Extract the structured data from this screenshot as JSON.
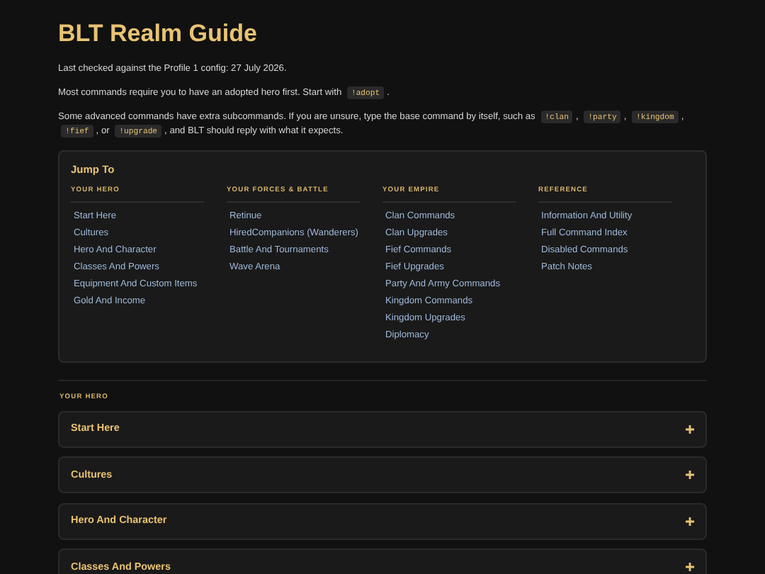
{
  "title": "BLT Realm Guide",
  "paragraphs": [
    [
      {
        "kind": "text",
        "text": "Last checked against the Profile 1 config: 27 July 2026."
      }
    ],
    [
      {
        "kind": "text",
        "text": "Most commands require you to have an adopted hero first. Start with"
      },
      {
        "kind": "code",
        "text": "!adopt"
      },
      {
        "kind": "text",
        "text": "."
      }
    ],
    [
      {
        "kind": "text",
        "text": "Some advanced commands have extra subcommands. If you are unsure, type the base command by itself, such as"
      },
      {
        "kind": "code",
        "text": "!clan"
      },
      {
        "kind": "text",
        "text": ","
      },
      {
        "kind": "code",
        "text": "!party"
      },
      {
        "kind": "text",
        "text": ","
      },
      {
        "kind": "code",
        "text": "!kingdom"
      },
      {
        "kind": "text",
        "text": ","
      },
      {
        "kind": "code",
        "text": "!fief"
      },
      {
        "kind": "text",
        "text": ", or"
      },
      {
        "kind": "code",
        "text": "!upgrade"
      },
      {
        "kind": "text",
        "text": ", and BLT should reply with what it expects."
      }
    ]
  ],
  "jump_to": {
    "title": "Jump To",
    "columns": [
      {
        "heading": "YOUR HERO",
        "links": [
          "Start Here",
          "Cultures",
          "Hero And Character",
          "Classes And Powers",
          "Equipment And Custom Items",
          "Gold And Income"
        ]
      },
      {
        "heading": "YOUR FORCES & BATTLE",
        "links": [
          "Retinue",
          "HiredCompanions (Wanderers)",
          "Battle And Tournaments",
          "Wave Arena"
        ]
      },
      {
        "heading": "YOUR EMPIRE",
        "links": [
          "Clan Commands",
          "Clan Upgrades",
          "Fief Commands",
          "Fief Upgrades",
          "Party And Army Commands",
          "Kingdom Commands",
          "Kingdom Upgrades",
          "Diplomacy"
        ]
      },
      {
        "heading": "REFERENCE",
        "links": [
          "Information And Utility",
          "Full Command Index",
          "Disabled Commands",
          "Patch Notes"
        ]
      }
    ]
  },
  "section": {
    "heading": "YOUR HERO",
    "items": [
      {
        "title": "Start Here",
        "expanded": false
      },
      {
        "title": "Cultures",
        "expanded": false
      },
      {
        "title": "Hero And Character",
        "expanded": false
      },
      {
        "title": "Classes And Powers",
        "expanded": false
      }
    ]
  }
}
